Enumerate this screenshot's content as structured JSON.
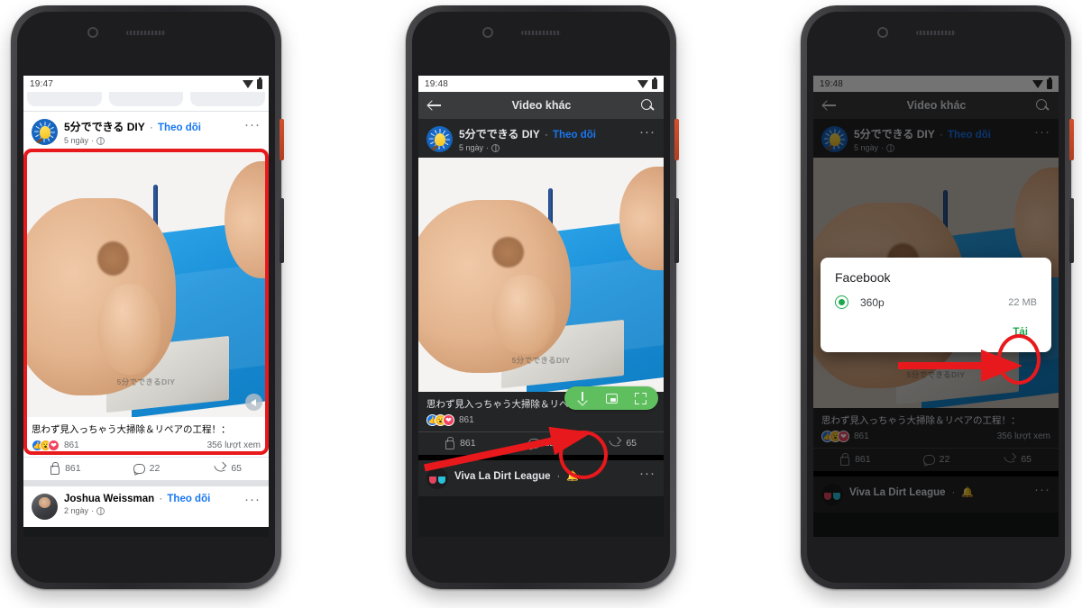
{
  "meta": {
    "scene": "three-android-phones-facebook-video-download-tutorial"
  },
  "phone1": {
    "status_bar": {
      "time": "19:47",
      "wifi_icon": "wifi-icon",
      "battery_icon": "battery-icon"
    },
    "tabs": [
      "",
      "",
      ""
    ],
    "post": {
      "author": "5分でできる DIY",
      "separator": "·",
      "follow_label": "Theo dõi",
      "time": "5 ngày",
      "privacy_icon": "globe-icon",
      "more_icon": "kebab-menu-icon",
      "video_watermark": "5分でできるDIY",
      "mute_icon": "speaker-mute-icon",
      "caption": "思わず見入っちゃう大掃除＆リペアの工程！：",
      "reactions": [
        "like-icon",
        "wow-icon",
        "love-icon"
      ],
      "reaction_count": "861",
      "views": "356 lượt xem",
      "actions": [
        {
          "icon": "thumbs-up-icon",
          "label": "861"
        },
        {
          "icon": "comment-icon",
          "label": "22"
        },
        {
          "icon": "share-icon",
          "label": "65"
        }
      ]
    },
    "next_post": {
      "author": "Joshua Weissman",
      "separator": "·",
      "follow_label": "Theo dõi",
      "time": "2 ngày",
      "privacy_icon": "globe-icon",
      "more_icon": "kebab-menu-icon"
    }
  },
  "phone2": {
    "status_bar": {
      "time": "19:48",
      "wifi_icon": "wifi-icon",
      "battery_icon": "battery-icon"
    },
    "top_bar": {
      "back_icon": "back-arrow-icon",
      "title": "Video khác",
      "search_icon": "search-icon"
    },
    "post": {
      "author": "5分でできる DIY",
      "separator": "·",
      "follow_label": "Theo dõi",
      "time": "5 ngày",
      "privacy_icon": "globe-icon",
      "more_icon": "kebab-menu-icon",
      "video_watermark": "5分でできるDIY",
      "caption": "思わず見入っちゃう大掃除＆リペアの工程！：",
      "reactions": [
        "like-icon",
        "wow-icon",
        "love-icon"
      ],
      "reaction_count": "861",
      "actions": [
        {
          "icon": "thumbs-up-icon",
          "label": "861"
        },
        {
          "icon": "comment-icon",
          "label": "22"
        },
        {
          "icon": "share-icon",
          "label": "65"
        }
      ]
    },
    "player_controls": [
      {
        "icon": "download-arrow-icon",
        "name": "download-button"
      },
      {
        "icon": "picture-in-picture-icon",
        "name": "pip-button"
      },
      {
        "icon": "fullscreen-icon",
        "name": "fullscreen-button"
      }
    ],
    "next_post": {
      "author": "Viva La Dirt League",
      "separator": "·",
      "bell_icon": "bell-icon",
      "more_icon": "kebab-menu-icon"
    }
  },
  "phone3": {
    "status_bar": {
      "time": "19:48",
      "wifi_icon": "wifi-icon",
      "battery_icon": "battery-icon"
    },
    "top_bar": {
      "back_icon": "back-arrow-icon",
      "title": "Video khác",
      "search_icon": "search-icon"
    },
    "post": {
      "author": "5分でできる DIY",
      "separator": "·",
      "follow_label": "Theo dõi",
      "time": "5 ngày",
      "privacy_icon": "globe-icon",
      "more_icon": "kebab-menu-icon",
      "video_watermark": "5分でできるDIY",
      "caption": "思わず見入っちゃう大掃除＆リペアの工程！：",
      "reactions": [
        "like-icon",
        "wow-icon",
        "love-icon"
      ],
      "reaction_count": "861",
      "views": "356 lượt xem",
      "actions": [
        {
          "icon": "thumbs-up-icon",
          "label": "861"
        },
        {
          "icon": "comment-icon",
          "label": "22"
        },
        {
          "icon": "share-icon",
          "label": "65"
        }
      ]
    },
    "dialog": {
      "title": "Facebook",
      "quality_selected": "360p",
      "file_size": "22 MB",
      "download_label": "Tải",
      "radio_icon": "radio-selected-icon"
    },
    "next_post": {
      "author": "Viva La Dirt League",
      "separator": "·",
      "bell_icon": "bell-icon",
      "more_icon": "kebab-menu-icon"
    }
  },
  "annotations": {
    "accent_color": "#e8191c",
    "phone1_highlight": "red-rectangle-around-video",
    "phone2_highlight": "red-circle-and-arrow-to-download-button",
    "phone3_highlight": "red-circle-and-arrow-to-download-confirm"
  }
}
